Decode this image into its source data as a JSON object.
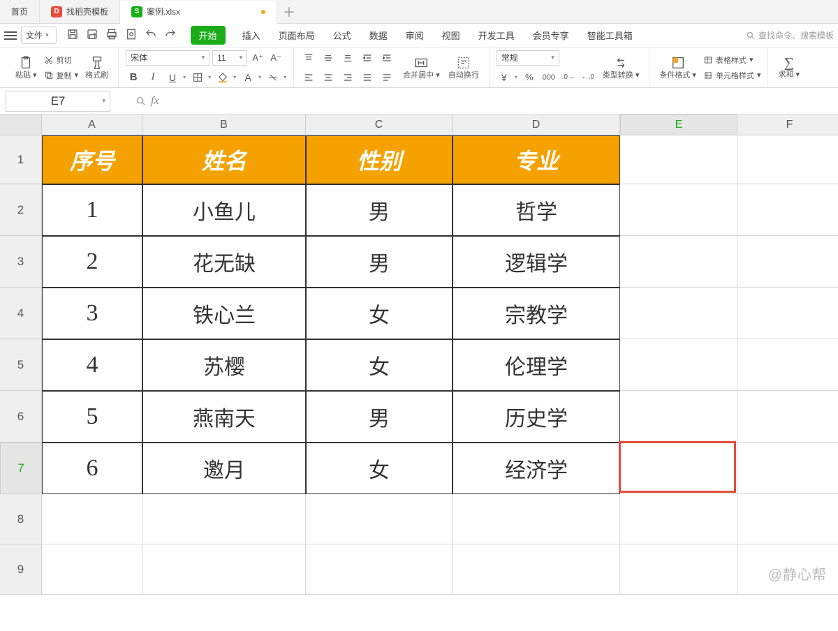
{
  "tabs": {
    "home": "首页",
    "t1": "找稻壳模板",
    "t2": "案例.xlsx"
  },
  "menu": {
    "file": "文件",
    "start": "开始",
    "insert": "插入",
    "layout": "页面布局",
    "formula": "公式",
    "data": "数据",
    "review": "审阅",
    "view": "视图",
    "dev": "开发工具",
    "vip": "会员专享",
    "smart": "智能工具箱",
    "search_placeholder": "查找命令、搜索模板"
  },
  "ribbon": {
    "paste": "粘贴",
    "cut": "剪切",
    "copy": "复制",
    "format_painter": "格式刷",
    "font_name": "宋体",
    "font_size": "11",
    "merge": "合并居中",
    "wrap": "自动换行",
    "number_format": "常规",
    "type_convert": "类型转换",
    "cond_format": "条件格式",
    "table_style": "表格样式",
    "cell_style": "单元格样式",
    "sum": "求和"
  },
  "namebox": "E7",
  "fx_symbol": "fx",
  "columns": [
    "A",
    "B",
    "C",
    "D",
    "E",
    "F"
  ],
  "rows": [
    "1",
    "2",
    "3",
    "4",
    "5",
    "6",
    "7",
    "8",
    "9"
  ],
  "table": {
    "headers": [
      "序号",
      "姓名",
      "性别",
      "专业"
    ],
    "data": [
      [
        "1",
        "小鱼儿",
        "男",
        "哲学"
      ],
      [
        "2",
        "花无缺",
        "男",
        "逻辑学"
      ],
      [
        "3",
        "铁心兰",
        "女",
        "宗教学"
      ],
      [
        "4",
        "苏樱",
        "女",
        "伦理学"
      ],
      [
        "5",
        "燕南天",
        "男",
        "历史学"
      ],
      [
        "6",
        "邀月",
        "女",
        "经济学"
      ]
    ]
  },
  "watermark": "@静心帮",
  "selected_cell": "E7"
}
